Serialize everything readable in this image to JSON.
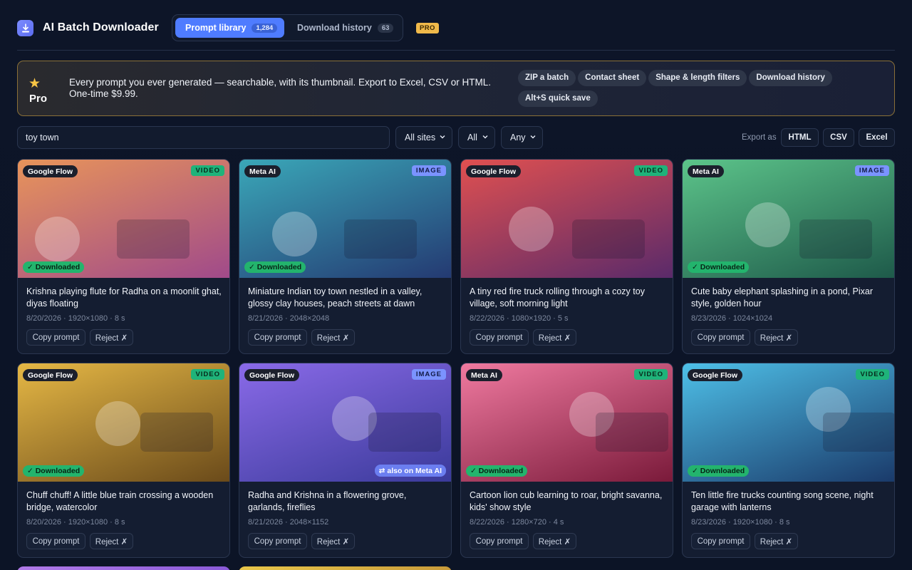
{
  "app": {
    "title": "AI Batch Downloader",
    "logo_icon": "download-icon"
  },
  "tabs": [
    {
      "label": "Prompt library",
      "count": "1,284"
    },
    {
      "label": "Download history",
      "count": "63"
    }
  ],
  "pro_badge": "PRO",
  "banner": {
    "badge": "Pro",
    "text": "Every prompt you ever generated — searchable, with its thumbnail. Export to Excel, CSV or HTML. One-time $9.99.",
    "features": [
      "ZIP a batch",
      "Contact sheet",
      "Shape & length filters",
      "Download history",
      "Alt+S quick save"
    ]
  },
  "filters": {
    "search_value": "toy town",
    "site": "All sites",
    "type": "All",
    "status": "Any"
  },
  "export": {
    "label": "Export as",
    "formats": [
      "HTML",
      "CSV",
      "Excel"
    ]
  },
  "card_actions": {
    "copy": "Copy prompt",
    "reject": "Reject ✗"
  },
  "downloaded_label": "✓ Downloaded",
  "cards": [
    {
      "site": "Google Flow",
      "type": "VIDEO",
      "downloaded": true,
      "prompt": "Krishna playing flute for Radha on a moonlit ghat, diyas floating",
      "meta": "8/20/2026 · 1920×1080 · 8 s",
      "colors": [
        "#e8945a",
        "#a04a8a"
      ]
    },
    {
      "site": "Meta AI",
      "type": "IMAGE",
      "downloaded": true,
      "prompt": "Miniature Indian toy town nestled in a valley, glossy clay houses, peach streets at dawn",
      "meta": "8/21/2026 · 2048×2048",
      "colors": [
        "#3aa7b8",
        "#243a72"
      ]
    },
    {
      "site": "Google Flow",
      "type": "VIDEO",
      "downloaded": false,
      "prompt": "A tiny red fire truck rolling through a cozy toy village, soft morning light",
      "meta": "8/22/2026 · 1080×1920 · 5 s",
      "colors": [
        "#e05050",
        "#5a2a6a"
      ]
    },
    {
      "site": "Meta AI",
      "type": "IMAGE",
      "downloaded": true,
      "prompt": "Cute baby elephant splashing in a pond, Pixar style, golden hour",
      "meta": "8/23/2026 · 1024×1024",
      "colors": [
        "#5cc48a",
        "#1e5a4a"
      ]
    },
    {
      "site": "Google Flow",
      "type": "VIDEO",
      "downloaded": true,
      "prompt": "Chuff chuff! A little blue train crossing a wooden bridge, watercolor",
      "meta": "8/20/2026 · 1920×1080 · 8 s",
      "colors": [
        "#e6b845",
        "#6a4a1a"
      ]
    },
    {
      "site": "Google Flow",
      "type": "IMAGE",
      "downloaded": false,
      "also_on": "⇄ also on Meta AI",
      "prompt": "Radha and Krishna in a flowering grove, garlands, fireflies",
      "meta": "8/21/2026 · 2048×1152",
      "colors": [
        "#8a6ae8",
        "#3a3a9a"
      ]
    },
    {
      "site": "Meta AI",
      "type": "VIDEO",
      "downloaded": true,
      "prompt": "Cartoon lion cub learning to roar, bright savanna, kids' show style",
      "meta": "8/22/2026 · 1280×720 · 4 s",
      "colors": [
        "#f07aa0",
        "#7a1a3a"
      ]
    },
    {
      "site": "Google Flow",
      "type": "VIDEO",
      "downloaded": true,
      "prompt": "Ten little fire trucks counting song scene, night garage with lanterns",
      "meta": "8/23/2026 · 1920×1080 · 8 s",
      "colors": [
        "#4ec0e8",
        "#1a3a6a"
      ]
    }
  ]
}
